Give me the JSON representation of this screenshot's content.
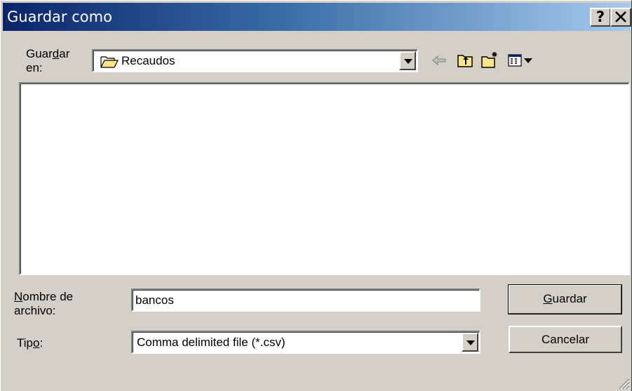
{
  "window": {
    "title": "Guardar como",
    "help_label": "?",
    "close_label": "✕"
  },
  "save_in": {
    "label": "Guardar en:",
    "folder": "Recaudos"
  },
  "toolbar": {
    "icons": [
      "back-arrow-icon",
      "up-one-level-icon",
      "new-folder-icon",
      "view-menu-icon"
    ]
  },
  "file_list": {
    "items": []
  },
  "filename": {
    "label": "Nombre de archivo:",
    "value": "bancos"
  },
  "filetype": {
    "label": "Tipo:",
    "value": "Comma delimited file (*.csv)"
  },
  "buttons": {
    "save": "Guardar",
    "cancel": "Cancelar"
  },
  "colors": {
    "titlebar_start": "#0a246a",
    "titlebar_end": "#a6caf0",
    "face": "#d4d0c8"
  }
}
